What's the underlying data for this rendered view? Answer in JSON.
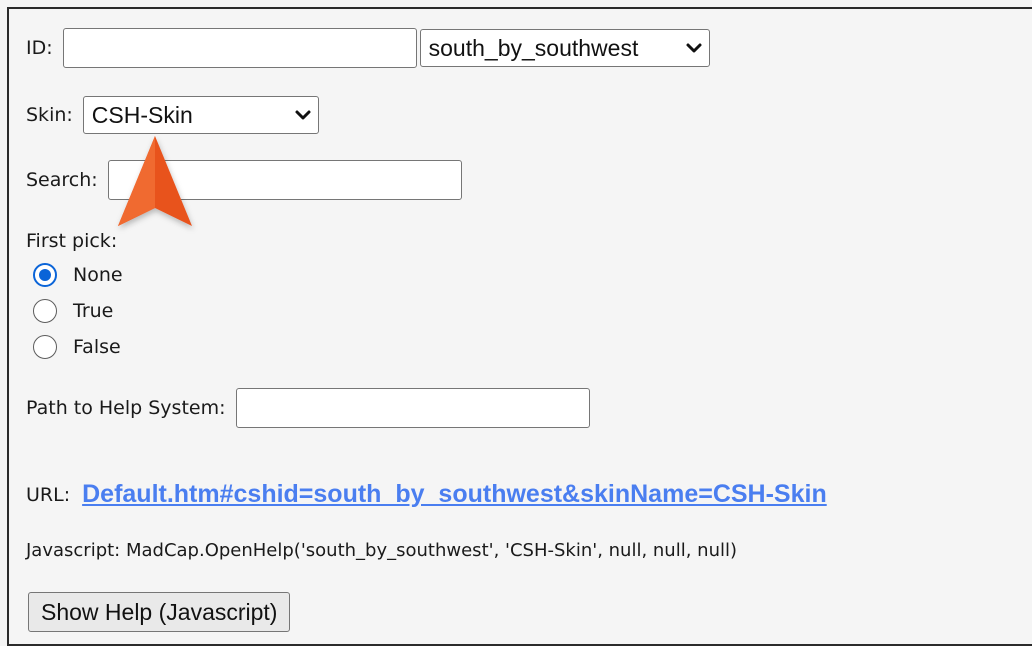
{
  "form": {
    "id_label": "ID:",
    "id_value": "",
    "id_select_value": "south_by_southwest",
    "skin_label": "Skin:",
    "skin_value": "CSH-Skin",
    "search_label": "Search:",
    "search_value": "",
    "first_pick_label": "First pick:",
    "radios": [
      {
        "label": "None",
        "checked": true
      },
      {
        "label": "True",
        "checked": false
      },
      {
        "label": "False",
        "checked": false
      }
    ],
    "path_label": "Path to Help System:",
    "path_value": "",
    "url_label": "URL:",
    "url_text": "Default.htm#cshid=south_by_southwest&skinName=CSH-Skin",
    "js_text": "Javascript: MadCap.OpenHelp('south_by_southwest', 'CSH-Skin', null, null, null)",
    "show_help_button": "Show Help (Javascript)"
  },
  "colors": {
    "pointer": "#e8521f",
    "link": "#4a7ef0",
    "radio_checked": "#0a64d8"
  },
  "icons": {
    "chevron": "chevron-down-icon",
    "pointer": "annotation-arrow-icon"
  }
}
